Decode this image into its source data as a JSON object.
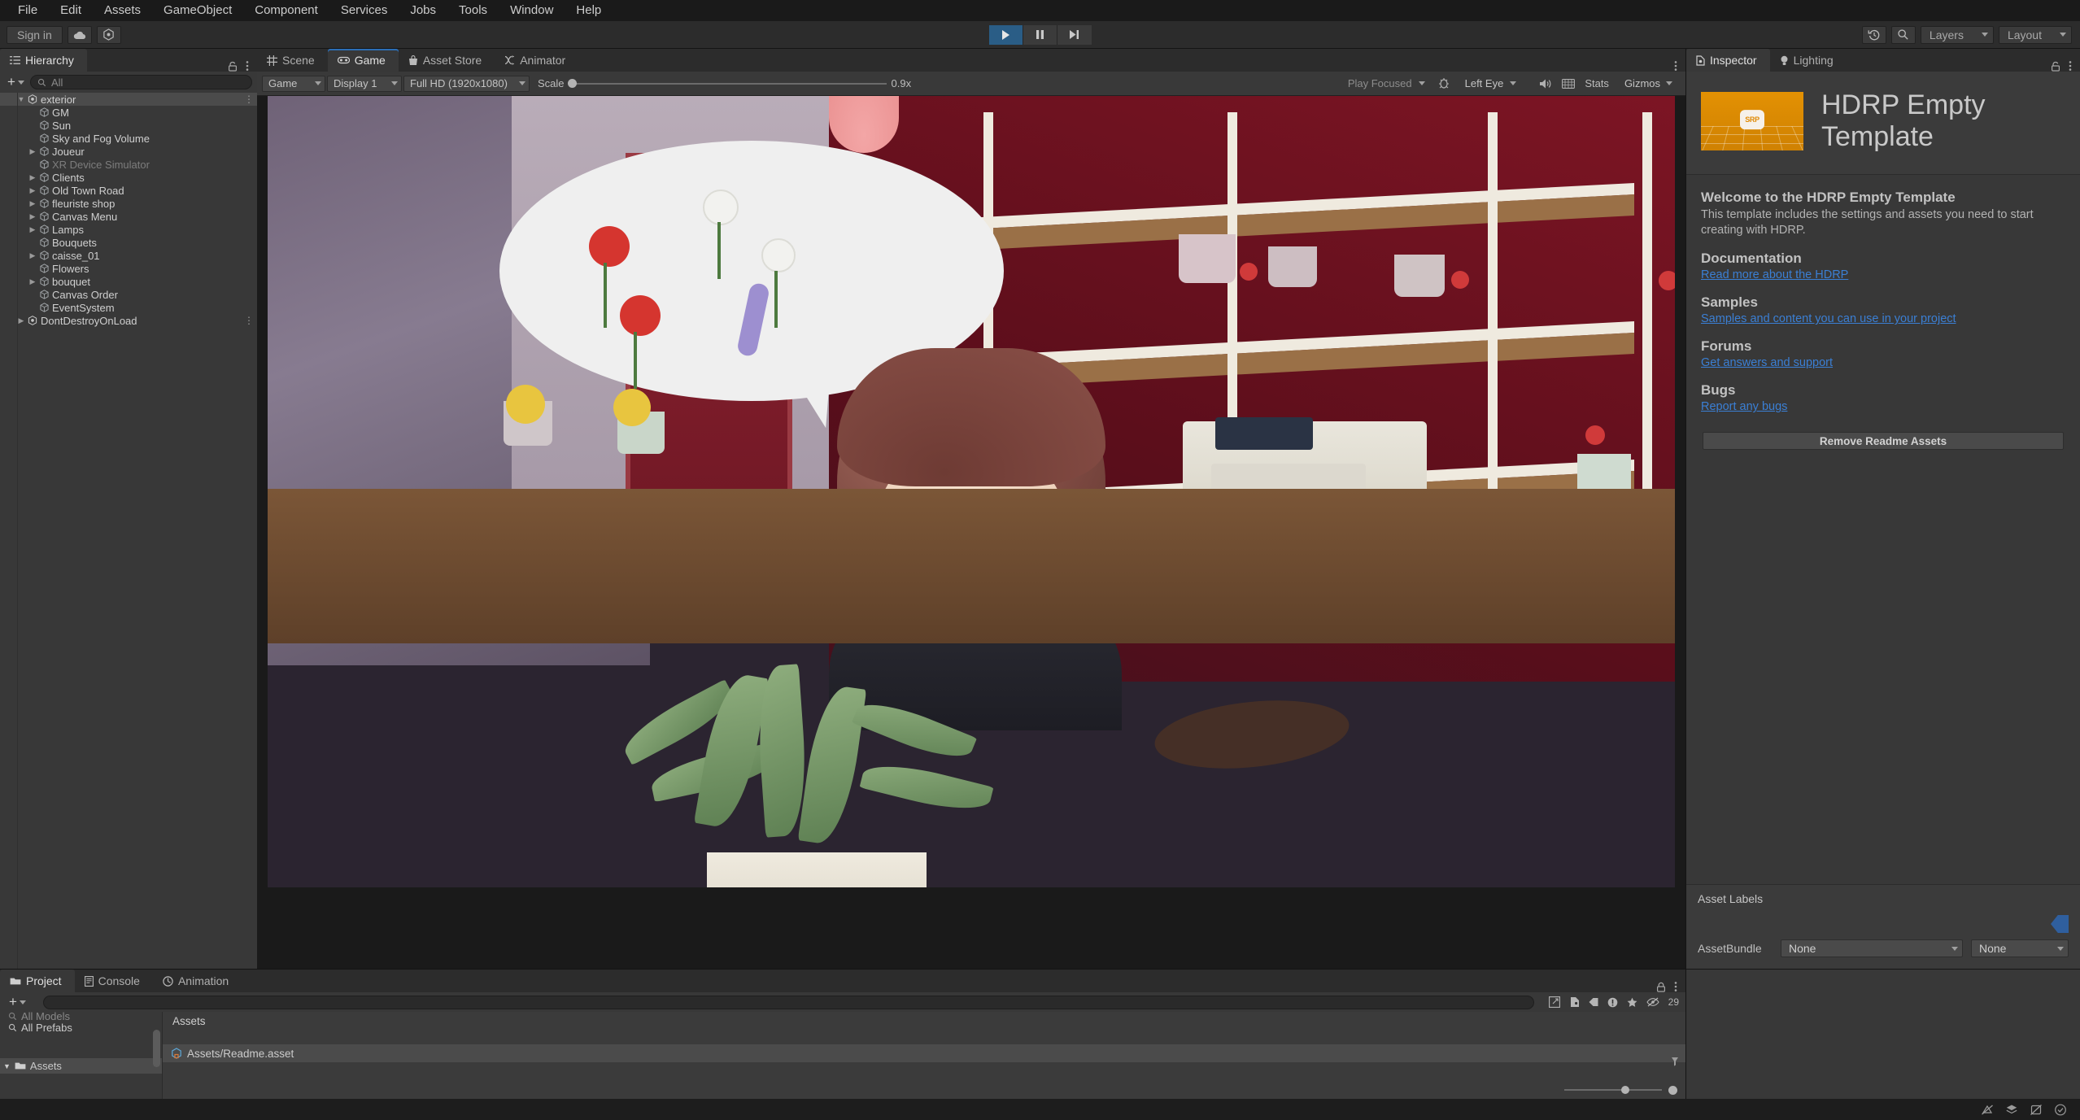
{
  "menubar": {
    "items": [
      "File",
      "Edit",
      "Assets",
      "GameObject",
      "Component",
      "Services",
      "Jobs",
      "Tools",
      "Window",
      "Help"
    ]
  },
  "toolbar": {
    "signin_label": "Sign in",
    "cloud_icon": "cloud-icon",
    "services_icon": "unity-services-icon",
    "play_icon": "play-icon",
    "pause_icon": "pause-icon",
    "step_icon": "step-icon",
    "history_icon": "undo-history-icon",
    "search_icon": "search-icon",
    "layers_label": "Layers",
    "layout_label": "Layout"
  },
  "hierarchy": {
    "tab_label": "Hierarchy",
    "tab_icon": "hierarchy-icon",
    "lock_icon": "lock-icon",
    "menu_icon": "kebab-menu-icon",
    "add_label": "+",
    "search_placeholder": "All",
    "items": [
      {
        "label": "exterior",
        "depth": 0,
        "twist": "open",
        "selected": true,
        "dim": false,
        "kebab": true
      },
      {
        "label": "GM",
        "depth": 1,
        "twist": "none",
        "selected": false,
        "dim": false
      },
      {
        "label": "Sun",
        "depth": 1,
        "twist": "none",
        "selected": false,
        "dim": false
      },
      {
        "label": "Sky and Fog Volume",
        "depth": 1,
        "twist": "none",
        "selected": false,
        "dim": false
      },
      {
        "label": "Joueur",
        "depth": 1,
        "twist": "closed",
        "selected": false,
        "dim": false
      },
      {
        "label": "XR Device Simulator",
        "depth": 1,
        "twist": "none",
        "selected": false,
        "dim": true
      },
      {
        "label": "Clients",
        "depth": 1,
        "twist": "closed",
        "selected": false,
        "dim": false
      },
      {
        "label": "Old Town Road",
        "depth": 1,
        "twist": "closed",
        "selected": false,
        "dim": false
      },
      {
        "label": "fleuriste shop",
        "depth": 1,
        "twist": "closed",
        "selected": false,
        "dim": false
      },
      {
        "label": "Canvas Menu",
        "depth": 1,
        "twist": "closed",
        "selected": false,
        "dim": false
      },
      {
        "label": "Lamps",
        "depth": 1,
        "twist": "closed",
        "selected": false,
        "dim": false
      },
      {
        "label": "Bouquets",
        "depth": 1,
        "twist": "none",
        "selected": false,
        "dim": false
      },
      {
        "label": "caisse_01",
        "depth": 1,
        "twist": "closed",
        "selected": false,
        "dim": false
      },
      {
        "label": "Flowers",
        "depth": 1,
        "twist": "none",
        "selected": false,
        "dim": false
      },
      {
        "label": "bouquet",
        "depth": 1,
        "twist": "closed",
        "selected": false,
        "dim": false
      },
      {
        "label": "Canvas Order",
        "depth": 1,
        "twist": "none",
        "selected": false,
        "dim": false
      },
      {
        "label": "EventSystem",
        "depth": 1,
        "twist": "none",
        "selected": false,
        "dim": false
      },
      {
        "label": "DontDestroyOnLoad",
        "depth": 0,
        "twist": "closed",
        "selected": false,
        "dim": false,
        "kebab": true
      }
    ]
  },
  "center_tabs": [
    {
      "label": "Scene",
      "icon": "scene-grid-icon",
      "selected": false
    },
    {
      "label": "Game",
      "icon": "gamepad-icon",
      "selected": true
    },
    {
      "label": "Asset Store",
      "icon": "store-bag-icon",
      "selected": false
    },
    {
      "label": "Animator",
      "icon": "animator-icon",
      "selected": false
    }
  ],
  "gameview": {
    "mode": "Game",
    "display": "Display 1",
    "resolution": "Full HD (1920x1080)",
    "scale_label": "Scale",
    "scale_value": "0.9x",
    "play_focused": "Play Focused",
    "eye": "Left Eye",
    "vr_icon": "vr-device-icon",
    "mute_icon": "mute-audio-icon",
    "stats_icon": "frame-debug-icon",
    "stats_label": "Stats",
    "gizmos_label": "Gizmos"
  },
  "inspector": {
    "tabs": [
      {
        "label": "Inspector",
        "icon": "inspector-icon",
        "selected": true
      },
      {
        "label": "Lighting",
        "icon": "lightbulb-icon",
        "selected": false
      }
    ],
    "lock_icon": "unlocked-icon",
    "menu_icon": "kebab-menu-icon",
    "readme": {
      "icon_badge": "SRP",
      "icon_name": "srp-template-thumbnail",
      "title": "HDRP Empty Template",
      "welcome_heading": "Welcome to the HDRP Empty Template",
      "welcome_body": "This template includes the settings and assets you need to start creating with HDRP.",
      "sections": [
        {
          "heading": "Documentation",
          "link": "Read more about the HDRP"
        },
        {
          "heading": "Samples",
          "link": "Samples and content you can use in your project"
        },
        {
          "heading": "Forums",
          "link": "Get answers and support"
        },
        {
          "heading": "Bugs",
          "link": "Report any bugs"
        }
      ],
      "remove_button": "Remove Readme Assets"
    },
    "asset_labels": {
      "title": "Asset Labels",
      "tag_icon": "label-tag-icon",
      "assetbundle_label": "AssetBundle",
      "assetbundle_value": "None",
      "variant_value": "None"
    }
  },
  "project": {
    "tabs": [
      {
        "label": "Project",
        "icon": "folder-icon",
        "selected": true
      },
      {
        "label": "Console",
        "icon": "console-icon",
        "selected": false
      },
      {
        "label": "Animation",
        "icon": "animation-clock-icon",
        "selected": false
      }
    ],
    "add_label": "+",
    "search_placeholder": "",
    "search_icon": "search-icon",
    "toolbar_icons": [
      "packages-icon",
      "favorite-icon",
      "label-icon",
      "warning-icon",
      "star-icon",
      "hidden-icon"
    ],
    "hidden_count": "29",
    "tree": [
      {
        "label": "All Models",
        "icon": "search-icon",
        "selected": false,
        "partial": true
      },
      {
        "label": "All Prefabs",
        "icon": "search-icon",
        "selected": false
      },
      {
        "label": "Assets",
        "icon": "folder-icon",
        "selected": true,
        "twist": "open"
      }
    ],
    "files_header": "Assets",
    "files": [
      {
        "label": "Assets/Readme.asset",
        "icon": "readme-asset-icon",
        "selected": true
      }
    ]
  },
  "statusbar": {
    "icons": [
      "no-collab-icon",
      "layers-status-icon",
      "no-sync-icon",
      "check-circle-icon"
    ]
  }
}
